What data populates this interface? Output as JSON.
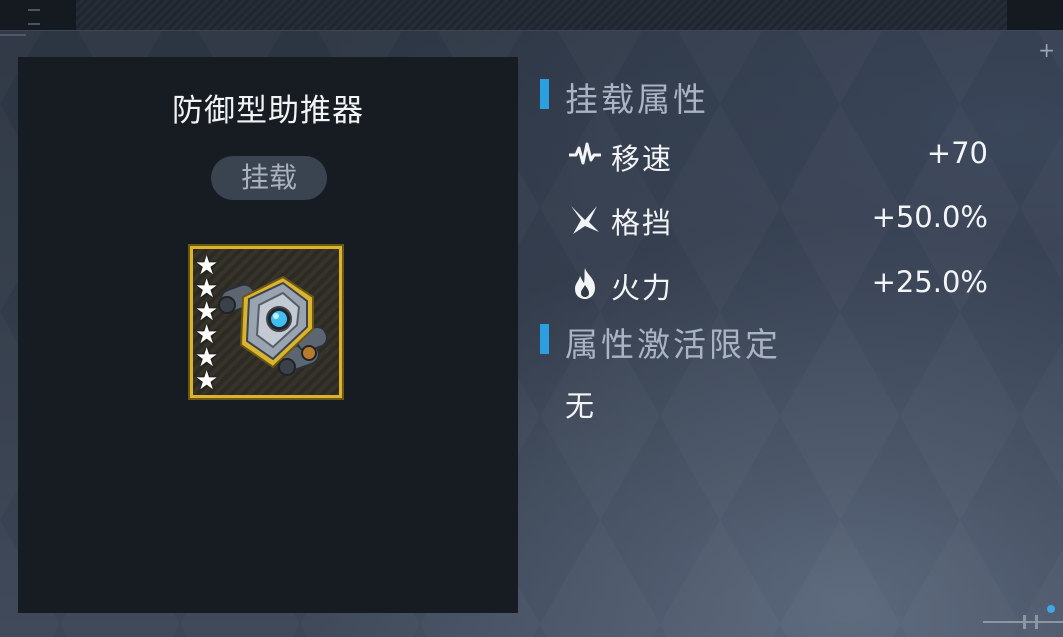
{
  "item": {
    "name": "防御型助推器",
    "status_badge": "挂载",
    "star_count": 6,
    "frame_color": "#d9b42c"
  },
  "mount_attributes": {
    "title": "挂载属性",
    "stats": [
      {
        "icon": "speed-pulse-icon",
        "label": "移速",
        "value": "+70"
      },
      {
        "icon": "block-slash-icon",
        "label": "格挡",
        "value": "+50.0%"
      },
      {
        "icon": "fire-icon",
        "label": "火力",
        "value": "+25.0%"
      }
    ]
  },
  "activation_limit": {
    "title": "属性激活限定",
    "value": "无"
  },
  "colors": {
    "accent": "#2b9fe0",
    "panel": "#171c23",
    "badge": "#3a4350"
  }
}
